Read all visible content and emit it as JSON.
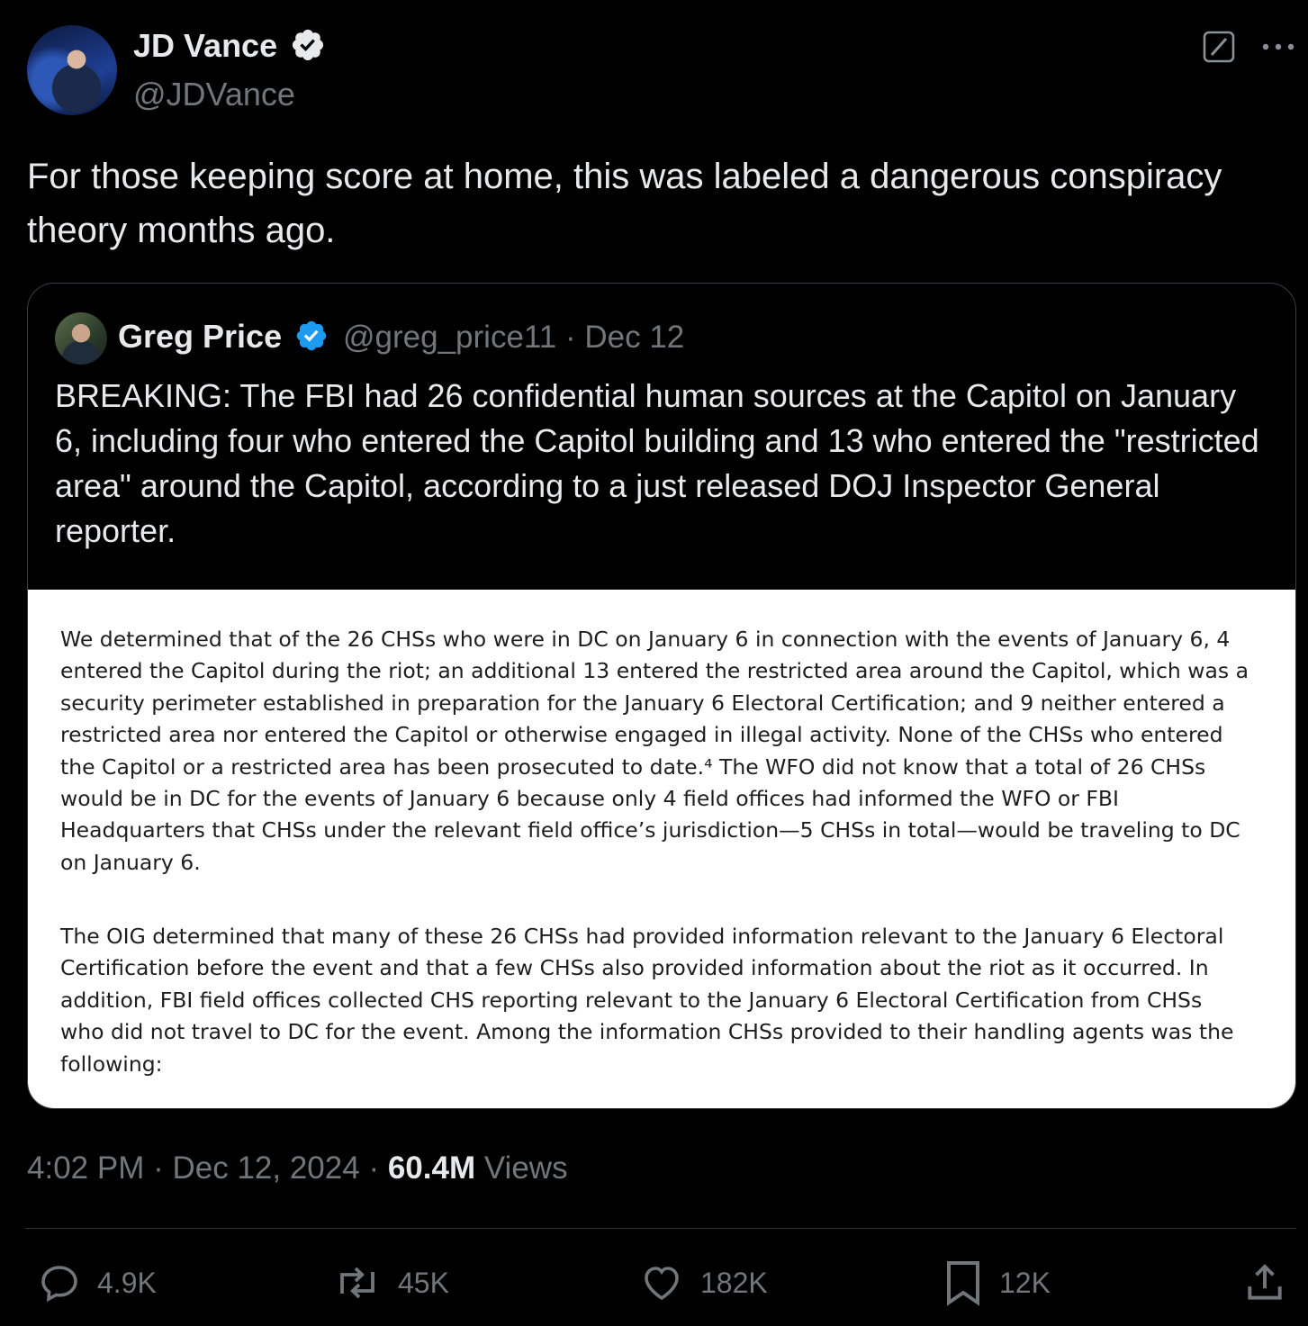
{
  "author": {
    "name": "JD Vance",
    "handle": "@JDVance"
  },
  "tweet": {
    "text": "For those keeping score at home, this was labeled a dangerous conspiracy theory months ago."
  },
  "quoted": {
    "name": "Greg Price",
    "handle": "@greg_price11",
    "separator": "·",
    "date": "Dec 12",
    "text": "BREAKING: The FBI had 26 confidential human sources at the Capitol on January 6, including four who entered the Capitol building and 13 who entered the \"restricted area\" around the Capitol, according to a just released DOJ Inspector General reporter.",
    "document": {
      "paragraph1": "We determined that of the 26 CHSs who were in DC on January 6 in connection with the events of January 6, 4 entered the Capitol during the riot; an additional 13 entered the restricted area around the Capitol, which was a security perimeter established in preparation for the January 6 Electoral Certification; and 9 neither entered a restricted area nor entered the Capitol or otherwise engaged in illegal activity.  None of the CHSs who entered the Capitol or a restricted area has been prosecuted to date.⁴  The WFO did not know that a total of 26 CHSs would be in DC for the events of January 6 because only 4 field offices had informed the WFO or FBI Headquarters that CHSs under the relevant field office’s jurisdiction—5 CHSs in total—would be traveling to DC on January 6.",
      "paragraph2": "The OIG determined that many of these 26 CHSs had provided information relevant to the January 6 Electoral Certification before the event and that a few CHSs also provided information about the riot as it occurred.  In addition, FBI field offices collected CHS reporting relevant to the January 6 Electoral Certification from CHSs who did not travel to DC for the event.  Among the information CHSs provided to their handling agents was the following:"
    }
  },
  "meta": {
    "time": "4:02 PM",
    "separator": "·",
    "date": "Dec 12, 2024",
    "views_count": "60.4M",
    "views_label": "Views"
  },
  "actions": {
    "replies": "4.9K",
    "reposts": "45K",
    "likes": "182K",
    "bookmarks": "12K"
  },
  "icons": [
    "verified-badge-icon",
    "grok-icon",
    "more-icon",
    "reply-icon",
    "repost-icon",
    "like-icon",
    "bookmark-icon",
    "share-icon"
  ],
  "colors": {
    "background": "#000000",
    "text": "#e7e9ea",
    "muted": "#71767b",
    "verified": "#1d9bf0"
  }
}
